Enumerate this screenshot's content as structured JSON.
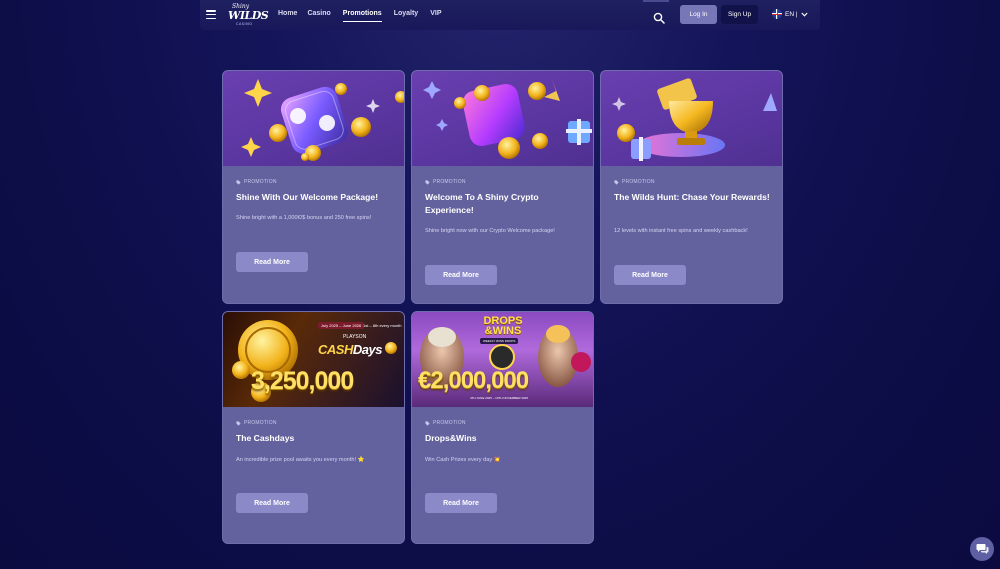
{
  "header": {
    "logo": {
      "line1": "Shiny",
      "line2": "WILDS",
      "line3": "CASINO"
    },
    "nav": [
      {
        "label": "Home"
      },
      {
        "label": "Casino"
      },
      {
        "label": "Promotions",
        "active": true
      },
      {
        "label": "Loyalty"
      },
      {
        "label": "VIP"
      }
    ],
    "login_label": "Log In",
    "signup_label": "Sign Up",
    "language": "EN |",
    "search_icon": "search-icon",
    "menu_icon": "hamburger-icon"
  },
  "promotions": [
    {
      "tag": "PROMOTION",
      "title": "Shine With Our Welcome Package!",
      "description": "Shine bright with a 1,000€/$ bonus and 250 free spins!",
      "button": "Read More"
    },
    {
      "tag": "PROMOTION",
      "title": "Welcome To A Shiny Crypto Experience!",
      "description": "Shine bright now with our Crypto Welcome package!",
      "button": "Read More"
    },
    {
      "tag": "PROMOTION",
      "title": "The Wilds Hunt: Chase Your Rewards!",
      "description": "12 levels with instant free spins and weekly cashback!",
      "button": "Read More"
    },
    {
      "tag": "PROMOTION",
      "title": "The Cashdays",
      "description": "An incredible prize pool awaits you every month! ⭐",
      "button": "Read More",
      "banner": {
        "dates": "July 2025 – June 2026",
        "period": "1st – 8th every month",
        "brand": "PLAYSON",
        "name_a": "CASH",
        "name_b": "Days",
        "amount": "3,250,000"
      }
    },
    {
      "tag": "PROMOTION",
      "title": "Drops&Wins",
      "description": "Win Cash Prizes every day 💥",
      "button": "Read More",
      "banner": {
        "name": "DROPS",
        "name2": "&WINS",
        "sub": "WEEKLY WINS DROPS",
        "amount": "€2,000,000",
        "dates": "4TH JUNE 2025 – 10TH NOVEMBER 2025"
      }
    }
  ],
  "chat_icon": "chat-bubble-icon",
  "colors": {
    "background": "#0d0d48",
    "card": "#64629e",
    "card_header": "#5a3a9a",
    "button": "#8b89c8",
    "login": "#7777b8"
  }
}
